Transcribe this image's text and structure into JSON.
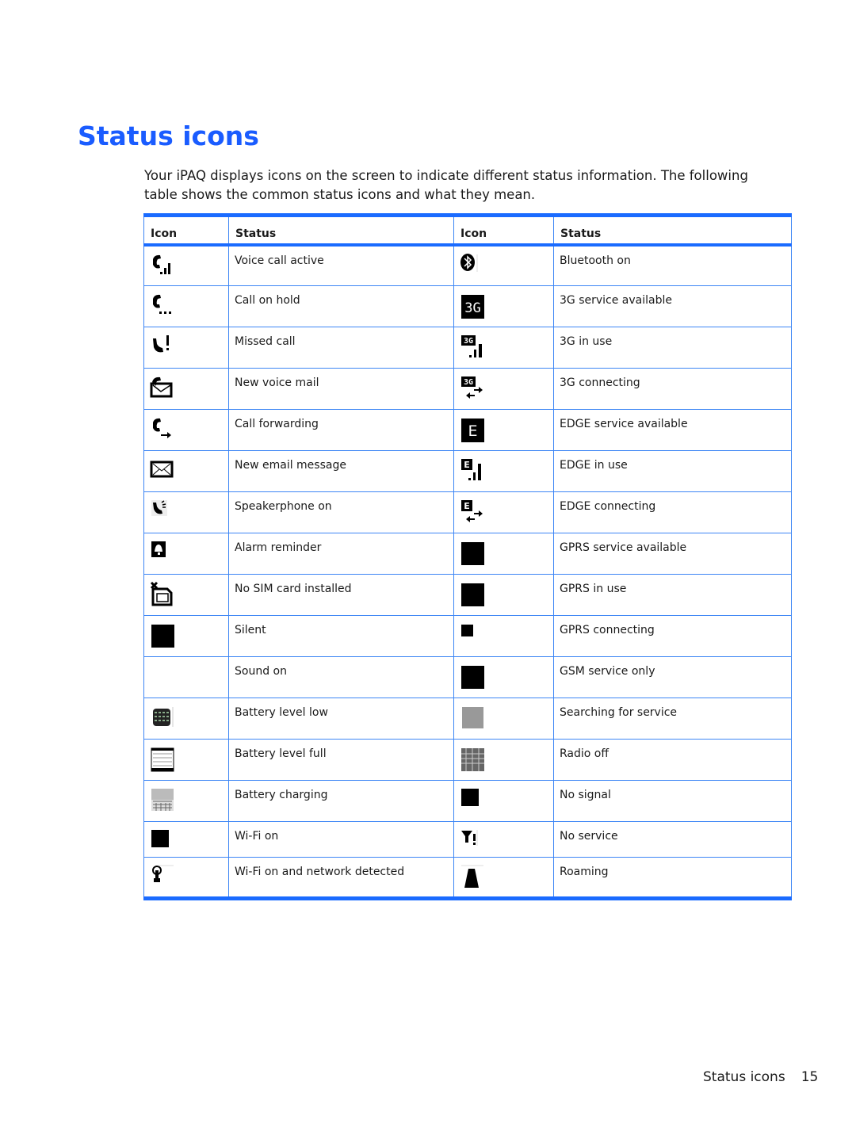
{
  "page": {
    "title": "Status icons",
    "intro": "Your iPAQ displays icons on the screen to indicate different status information. The following table shows the common status icons and what they mean.",
    "footer_section": "Status icons",
    "page_number": "15"
  },
  "table": {
    "headers": [
      "Icon",
      "Status",
      "Icon",
      "Status"
    ],
    "accent_color": "#1a6bff",
    "rows": [
      {
        "left_icon": "voice-call-active-icon",
        "left_status": "Voice call active",
        "right_icon": "bluetooth-icon",
        "right_status": "Bluetooth on"
      },
      {
        "left_icon": "call-on-hold-icon",
        "left_status": "Call on hold",
        "right_icon": "3g-icon",
        "right_status": "3G service available"
      },
      {
        "left_icon": "missed-call-icon",
        "left_status": "Missed call",
        "right_icon": "3g-in-use-icon",
        "right_status": "3G in use"
      },
      {
        "left_icon": "voice-mail-icon",
        "left_status": "New voice mail",
        "right_icon": "3g-connecting-icon",
        "right_status": "3G connecting"
      },
      {
        "left_icon": "call-forwarding-icon",
        "left_status": "Call forwarding",
        "right_icon": "edge-icon",
        "right_status": "EDGE service available"
      },
      {
        "left_icon": "email-icon",
        "left_status": "New email message",
        "right_icon": "edge-in-use-icon",
        "right_status": "EDGE in use"
      },
      {
        "left_icon": "speakerphone-icon",
        "left_status": "Speakerphone on",
        "right_icon": "edge-connecting-icon",
        "right_status": "EDGE connecting"
      },
      {
        "left_icon": "alarm-bell-icon",
        "left_status": "Alarm reminder",
        "right_icon": "gprs-icon",
        "right_status": "GPRS service available"
      },
      {
        "left_icon": "no-sim-icon",
        "left_status": "No SIM card installed",
        "right_icon": "gprs-in-use-icon",
        "right_status": "GPRS in use"
      },
      {
        "left_icon": "silent-icon",
        "left_status": "Silent",
        "right_icon": "gprs-connecting-icon",
        "right_status": "GPRS connecting"
      },
      {
        "left_icon": "sound-on-icon",
        "left_status": "Sound on",
        "right_icon": "gsm-icon",
        "right_status": "GSM service only"
      },
      {
        "left_icon": "battery-low-icon",
        "left_status": "Battery level low",
        "right_icon": "searching-icon",
        "right_status": "Searching for service"
      },
      {
        "left_icon": "battery-full-icon",
        "left_status": "Battery level full",
        "right_icon": "radio-off-icon",
        "right_status": "Radio off"
      },
      {
        "left_icon": "battery-charging-icon",
        "left_status": "Battery charging",
        "right_icon": "no-signal-icon",
        "right_status": "No signal"
      },
      {
        "left_icon": "wifi-on-icon",
        "left_status": "Wi-Fi on",
        "right_icon": "no-service-icon",
        "right_status": "No service"
      },
      {
        "left_icon": "wifi-network-icon",
        "left_status": "Wi-Fi on and network detected",
        "right_icon": "roaming-icon",
        "right_status": "Roaming"
      }
    ]
  }
}
